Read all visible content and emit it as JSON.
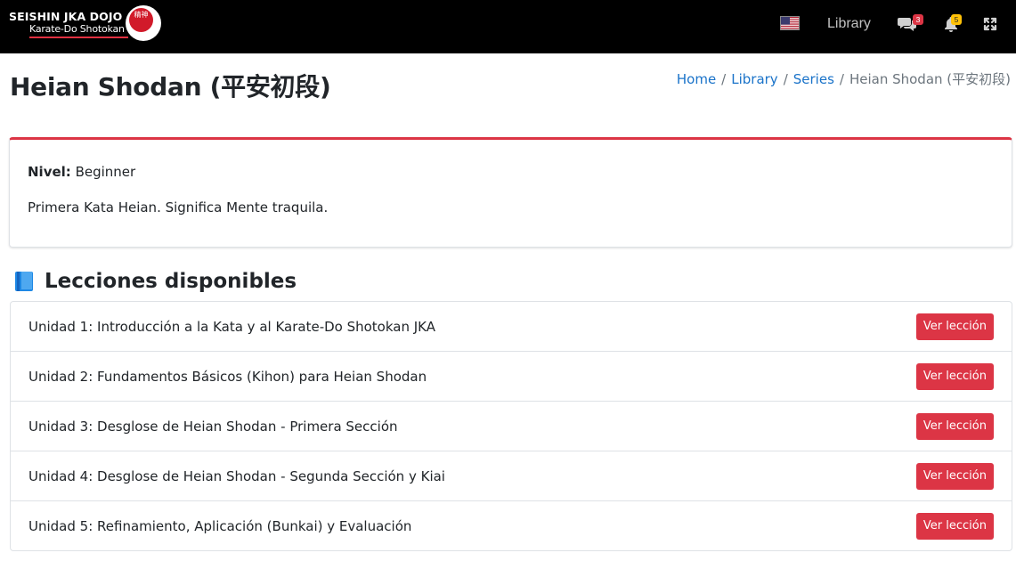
{
  "brand": {
    "name": "SEISHIN JKA DOJO",
    "subtitle": "Karate-Do Shotokan",
    "seal_text": "精神"
  },
  "navbar": {
    "flag_icon": "us-flag-icon",
    "library_label": "Library",
    "chat_badge": "3",
    "notifications_badge": "5",
    "colors": {
      "background": "#000000",
      "badge_red": "#dc3545",
      "badge_yellow": "#ffc107"
    }
  },
  "header": {
    "title": "Heian Shodan (平安初段)",
    "breadcrumb": {
      "home": "Home",
      "library": "Library",
      "series": "Series",
      "current": "Heian Shodan (平安初段)"
    }
  },
  "info": {
    "level_label": "Nivel:",
    "level_value": "Beginner",
    "description": "Primera Kata Heian. Significa Mente traquila."
  },
  "lessons": {
    "heading": "Lecciones disponibles",
    "heading_icon": "blue-book-icon",
    "button_label": "Ver lección",
    "items": [
      {
        "title": "Unidad 1: Introducción a la Kata y al Karate-Do Shotokan JKA"
      },
      {
        "title": "Unidad 2: Fundamentos Básicos (Kihon) para Heian Shodan"
      },
      {
        "title": "Unidad 3: Desglose de Heian Shodan - Primera Sección"
      },
      {
        "title": "Unidad 4: Desglose de Heian Shodan - Segunda Sección y Kiai"
      },
      {
        "title": "Unidad 5: Refinamiento, Aplicación (Bunkai) y Evaluación"
      }
    ]
  },
  "colors": {
    "accent": "#dc3545",
    "link": "#1a73c9"
  }
}
